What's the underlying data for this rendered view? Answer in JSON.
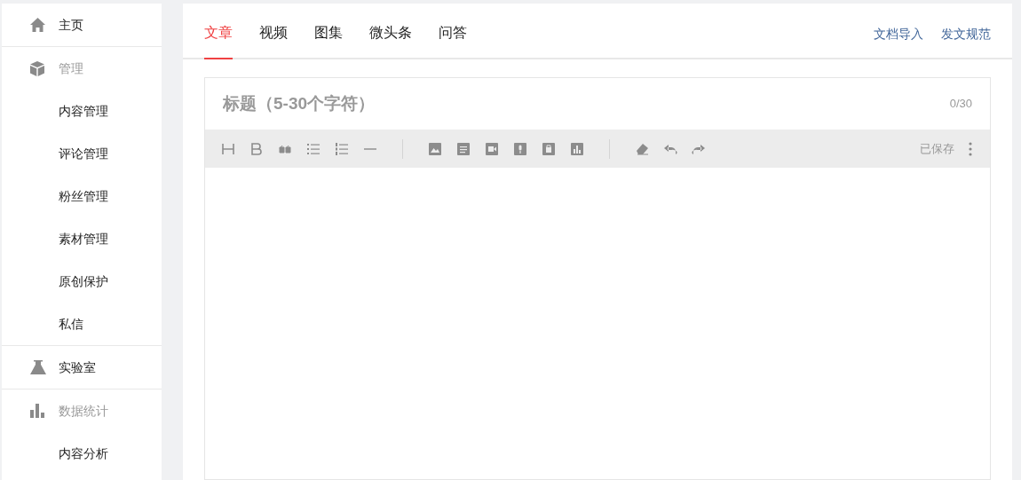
{
  "sidebar": {
    "sections": [
      {
        "kind": "link",
        "label": "主页"
      },
      {
        "kind": "group",
        "label": "管理",
        "children": [
          "内容管理",
          "评论管理",
          "粉丝管理",
          "素材管理",
          "原创保护",
          "私信"
        ]
      },
      {
        "kind": "link",
        "label": "实验室"
      },
      {
        "kind": "group",
        "label": "数据统计",
        "children": [
          "内容分析"
        ]
      }
    ]
  },
  "tabs": [
    {
      "label": "文章",
      "selected": true
    },
    {
      "label": "视频",
      "selected": false
    },
    {
      "label": "图集",
      "selected": false
    },
    {
      "label": "微头条",
      "selected": false
    },
    {
      "label": "问答",
      "selected": false
    }
  ],
  "header_links": [
    "文档导入",
    "发文规范"
  ],
  "editor": {
    "title_placeholder": "标题（5-30个字符）",
    "counter": "0/30",
    "saved_status": "已保存"
  }
}
